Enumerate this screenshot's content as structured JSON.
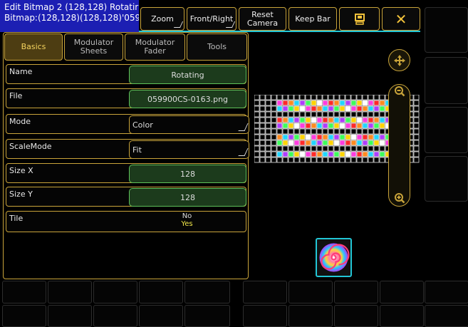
{
  "window": {
    "title_line1": "Edit Bitmap 2 (128,128) Rotatir",
    "title_line2": "Bitmap:(128,128)(128,128)'059"
  },
  "toolbar": {
    "zoom": "Zoom",
    "view": "Front/Right",
    "reset_line1": "Reset",
    "reset_line2": "Camera",
    "keep_bar": "Keep Bar"
  },
  "tabs": [
    {
      "label_line1": "Basics",
      "label_line2": ""
    },
    {
      "label_line1": "Modulator",
      "label_line2": "Sheets"
    },
    {
      "label_line1": "Modulator",
      "label_line2": "Fader"
    },
    {
      "label_line1": "Tools",
      "label_line2": ""
    }
  ],
  "properties": {
    "name": {
      "label": "Name",
      "value": "Rotating"
    },
    "file": {
      "label": "File",
      "value": "059900CS-0163.png"
    },
    "mode": {
      "label": "Mode",
      "value": "Color"
    },
    "scale_mode": {
      "label": "ScaleMode",
      "value": "Fit"
    },
    "size_x": {
      "label": "Size X",
      "value": "128"
    },
    "size_y": {
      "label": "Size Y",
      "value": "128"
    },
    "tile": {
      "label": "Tile",
      "option_no": "No",
      "option_yes": "Yes"
    }
  },
  "icons": {
    "pan": "move-arrows-icon",
    "zoom_out": "zoom-out-icon",
    "zoom_in": "zoom-in-icon",
    "window_toggle": "window-icon",
    "close": "close-icon"
  },
  "colors": {
    "accent": "#c9a43a",
    "title_bg": "#1c1fb3",
    "cyan": "#22c6d6",
    "active_tab": "#4d3d12",
    "green": "#5fc35a",
    "yes": "#f2e84a"
  }
}
